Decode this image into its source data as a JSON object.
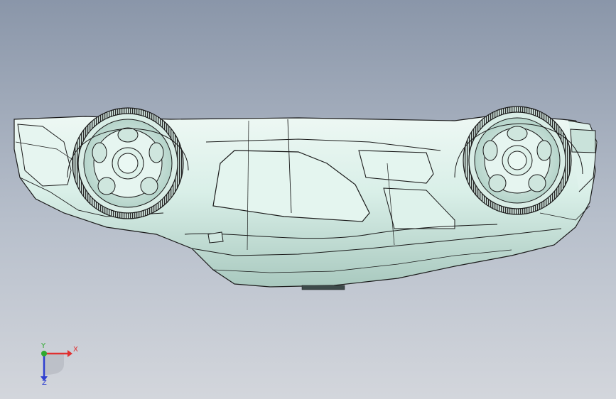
{
  "viewport": {
    "background_top": "#8a96a9",
    "background_bottom": "#d3d6dc",
    "model_color": "#d6ede6",
    "edge_color": "#1a1a1a"
  },
  "triad": {
    "x_label": "X",
    "y_label": "Y",
    "z_label": "Z",
    "x_color": "#e03030",
    "y_color": "#2faa2f",
    "z_color": "#2f3fd0"
  }
}
